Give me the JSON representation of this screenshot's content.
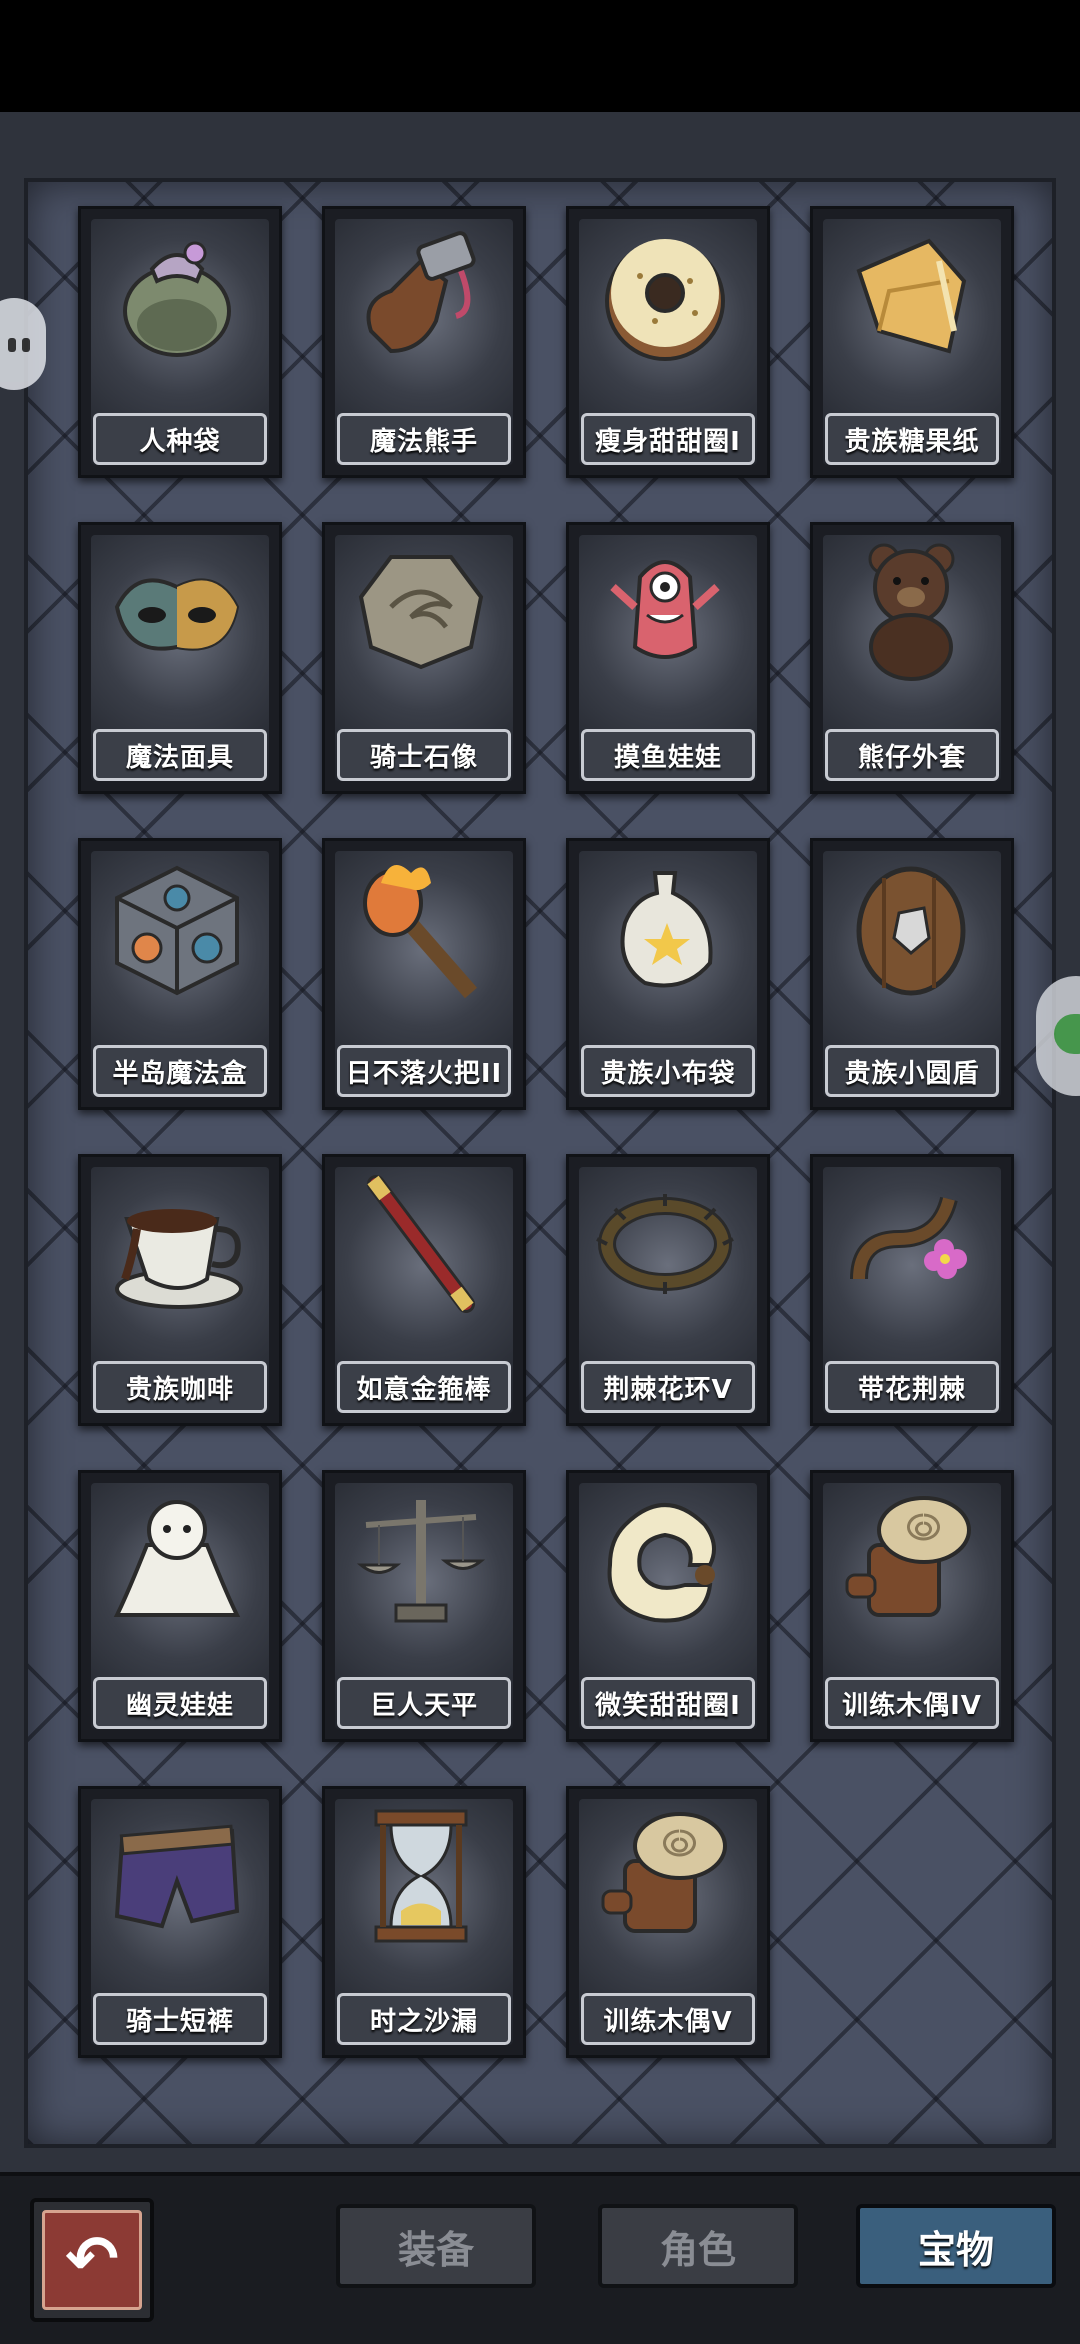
{
  "items": [
    {
      "name": "人种袋",
      "icon": "pouch-icon"
    },
    {
      "name": "魔法熊手",
      "icon": "bear-paw-icon"
    },
    {
      "name": "瘦身甜甜圈I",
      "icon": "donut-icon"
    },
    {
      "name": "贵族糖果纸",
      "icon": "candy-wrapper-icon"
    },
    {
      "name": "魔法面具",
      "icon": "mask-icon"
    },
    {
      "name": "骑士石像",
      "icon": "stone-plaque-icon"
    },
    {
      "name": "摸鱼娃娃",
      "icon": "doll-icon"
    },
    {
      "name": "熊仔外套",
      "icon": "teddy-bear-icon"
    },
    {
      "name": "半岛魔法盒",
      "icon": "magic-cube-icon"
    },
    {
      "name": "日不落火把II",
      "icon": "torch-icon"
    },
    {
      "name": "贵族小布袋",
      "icon": "cloth-bag-icon"
    },
    {
      "name": "贵族小圆盾",
      "icon": "round-shield-icon"
    },
    {
      "name": "贵族咖啡",
      "icon": "coffee-cup-icon"
    },
    {
      "name": "如意金箍棒",
      "icon": "staff-icon"
    },
    {
      "name": "荆棘花环V",
      "icon": "thorn-wreath-icon"
    },
    {
      "name": "带花荆棘",
      "icon": "flower-thorn-icon"
    },
    {
      "name": "幽灵娃娃",
      "icon": "ghost-doll-icon"
    },
    {
      "name": "巨人天平",
      "icon": "scale-icon"
    },
    {
      "name": "微笑甜甜圈I",
      "icon": "smile-donut-icon"
    },
    {
      "name": "训练木偶IV",
      "icon": "training-dummy-icon"
    },
    {
      "name": "骑士短裤",
      "icon": "shorts-icon"
    },
    {
      "name": "时之沙漏",
      "icon": "hourglass-icon"
    },
    {
      "name": "训练木偶V",
      "icon": "training-dummy-icon"
    }
  ],
  "tabs": {
    "equipment": "装备",
    "character": "角色",
    "treasure": "宝物"
  },
  "back_icon": "back-arrow-icon"
}
